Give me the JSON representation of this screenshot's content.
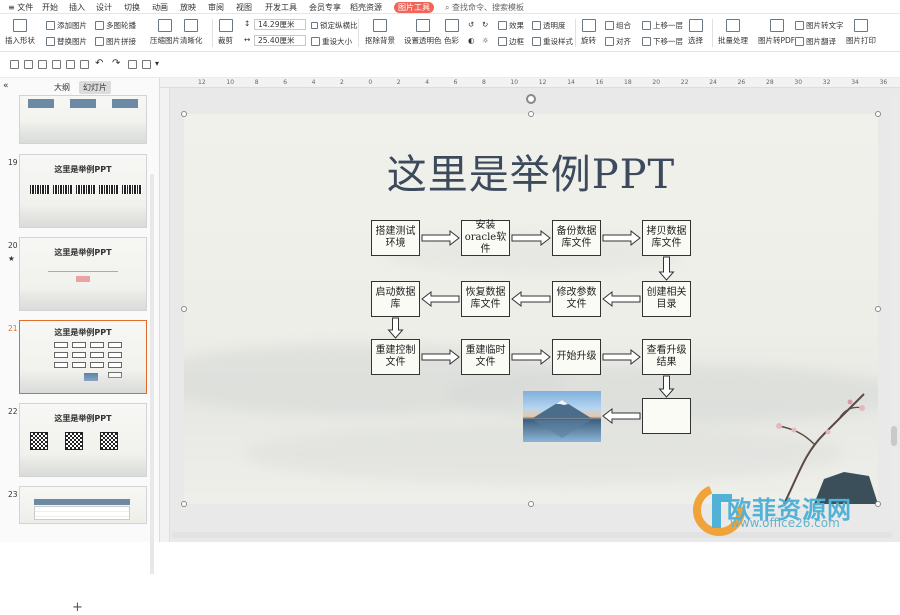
{
  "menu": {
    "file": "文件",
    "items": [
      "开始",
      "插入",
      "设计",
      "切换",
      "动画",
      "放映",
      "审阅",
      "视图",
      "开发工具",
      "会员专享",
      "稻壳资源"
    ],
    "active_tab": "图片工具",
    "search": "查找命令、搜索模板"
  },
  "ribbon": {
    "insert_shape": "插入形状",
    "add_picture": "添加图片",
    "replace_picture": "替换图片",
    "multi_picture": "多图轮播",
    "picture_stitch": "图片拼接",
    "compress": "压缩图片",
    "sharpen": "清晰化",
    "crop": "裁剪",
    "width": "14.29厘米",
    "height": "25.40厘米",
    "lock_ratio": "锁定纵横比",
    "reset_size": "重设大小",
    "cutout": "抠除背景",
    "set_transparent": "设置透明色",
    "color": "色彩",
    "effects": "效果",
    "transparency": "透明度",
    "border": "边框",
    "reset_style": "重设样式",
    "rotate": "旋转",
    "group": "组合",
    "align": "对齐",
    "bring_forward": "上移一层",
    "send_backward": "下移一层",
    "select": "选择",
    "batch": "批量处理",
    "to_pdf": "图片转PDF",
    "to_text": "图片转文字",
    "translate": "图片翻译",
    "print": "图片打印"
  },
  "panel": {
    "tab_outline": "大纲",
    "tab_slides": "幻灯片",
    "slides": [
      {
        "num": "",
        "title": ""
      },
      {
        "num": "19",
        "title": "这里是举例PPT"
      },
      {
        "num": "20",
        "title": "这里是举例PPT",
        "mark": "★"
      },
      {
        "num": "21",
        "title": "这里是举例PPT",
        "selected": true
      },
      {
        "num": "22",
        "title": "这里是举例PPT"
      },
      {
        "num": "23",
        "title": ""
      }
    ],
    "add": "+"
  },
  "ruler": {
    "marks": [
      "12",
      "10",
      "8",
      "6",
      "4",
      "2",
      "0",
      "2",
      "4",
      "6",
      "8",
      "10",
      "12",
      "14",
      "16",
      "18",
      "20",
      "22",
      "24",
      "26",
      "28",
      "30",
      "32",
      "34",
      "36"
    ]
  },
  "slide": {
    "title": "这里是举例PPT",
    "flow": [
      "搭建测试环境",
      "安装oracle软件",
      "备份数据库文件",
      "拷贝数据库文件",
      "启动数据库",
      "恢复数据库文件",
      "修改参数文件",
      "创建相关目录",
      "重建控制文件",
      "重建临时文件",
      "开始升级",
      "查看升级结果",
      ""
    ]
  },
  "watermark": {
    "text": "欧菲资源网",
    "url": "www.office26.com"
  }
}
